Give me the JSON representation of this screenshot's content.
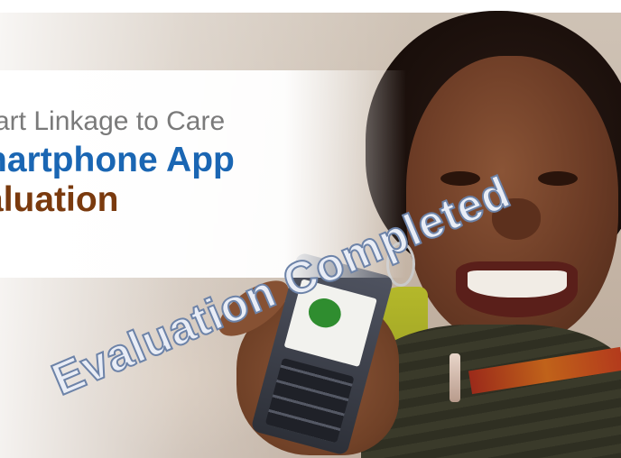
{
  "slide": {
    "title_line1": "art Linkage to Care",
    "title_line2": "nartphone App",
    "title_line3": "aluation",
    "stamp_text": "Evaluation Completed"
  },
  "colors": {
    "line1": "#7a7a7a",
    "line2": "#1a66b3",
    "line3": "#7a3a0e",
    "stamp_fill": "#e9edf6",
    "stamp_outline": "#6d83a8"
  },
  "icons": [
    "phone-icon"
  ]
}
